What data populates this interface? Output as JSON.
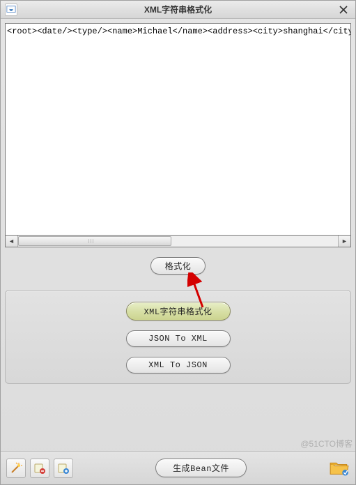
{
  "title": "XML字符串格式化",
  "xml_content": "<root><date/><type/><name>Michael</name><address><city>shanghai</city><street>Cha",
  "format_button": "格式化",
  "tabs": {
    "xml_format": "XML字符串格式化",
    "json_to_xml": "JSON To XML",
    "xml_to_json": "XML To JSON"
  },
  "bottom": {
    "generate_bean": "生成Bean文件"
  },
  "watermark": "@51CTO博客"
}
